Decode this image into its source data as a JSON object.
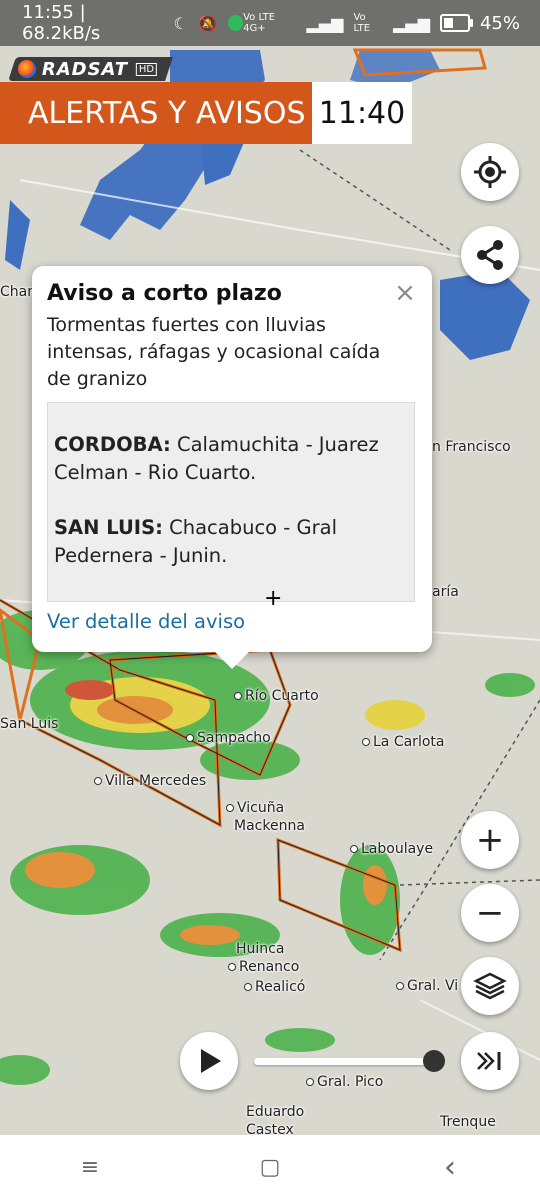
{
  "status_bar": {
    "time_speed": "11:55 | 68.2kB/s",
    "network1": "Vo LTE 4G+",
    "network2": "Vo LTE",
    "battery": "45%",
    "battery_level": 0.45
  },
  "app": {
    "brand": "RADSAT",
    "brand_suffix": "HD"
  },
  "header": {
    "title": "ALERTAS Y AVISOS",
    "time": "11:40"
  },
  "popup": {
    "title": "Aviso a corto plazo",
    "description": "Tormentas fuertes con lluvias intensas, ráfagas y ocasional caída de granizo",
    "zones": [
      {
        "province": "CORDOBA:",
        "areas": "Calamuchita - Juarez Celman - Rio Cuarto."
      },
      {
        "province": "SAN LUIS:",
        "areas": "Chacabuco - Gral Pedernera - Junin."
      }
    ],
    "link": "Ver detalle del aviso",
    "close": "×",
    "cursor": "+"
  },
  "map_labels": {
    "cham": "Cham",
    "san_francisco": "n Francisco",
    "maria": "aría",
    "rio_cuarto": "Río Cuarto",
    "sampacho": "Sampacho",
    "la_carlota": "La Carlota",
    "san_luis": "San Luis",
    "villa_mercedes": "Villa Mercedes",
    "vicuna": "Vicuña",
    "mackenna": "Mackenna",
    "laboulaye": "Laboulaye",
    "huinca": "Huinca",
    "renanco": "Renanco",
    "realico": "Realicó",
    "gral_vi": "Gral. Vi",
    "gral_pico": "Gral. Pico",
    "eduardo": "Eduardo",
    "castex": "Castex",
    "trenque": "Trenque"
  },
  "controls": {
    "zoom_in": "+",
    "zoom_out": "−"
  },
  "playback": {
    "progress": 1.0
  },
  "navbar": {
    "menu": "≡",
    "home": "▢",
    "back": "‹"
  }
}
